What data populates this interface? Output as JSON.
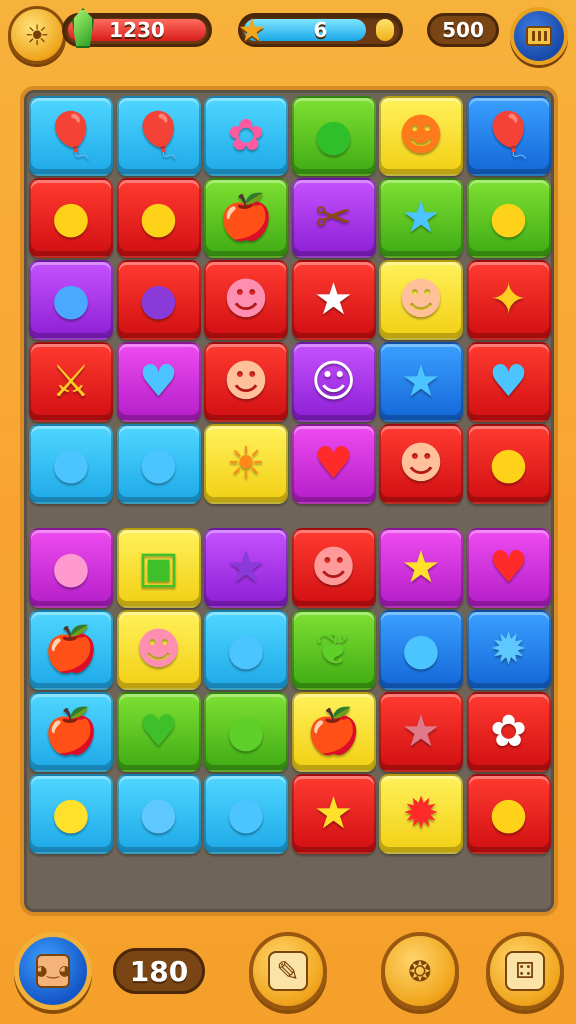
{
  "hud": {
    "hp_value": "1230",
    "level_value": "6",
    "level_progress": 0.8,
    "coins": "500",
    "avatar_icon": "sun-badge-icon",
    "gem_icon": "green-gem-icon",
    "star_icon": "star-icon",
    "pause_icon": "pause-menu-icon"
  },
  "board": {
    "columns": 6,
    "rows": [
      [
        {
          "color": "cyan",
          "item": "globe-balloon",
          "glyph": "🎈"
        },
        {
          "color": "cyan",
          "item": "blue-balloon",
          "glyph": "🎈"
        },
        {
          "color": "cyan",
          "item": "flower-bouquet",
          "glyph": "✿"
        },
        {
          "color": "green",
          "item": "green-blob",
          "glyph": "●"
        },
        {
          "color": "yellow",
          "item": "orange-face",
          "glyph": "☻"
        },
        {
          "color": "blue",
          "item": "blue-balloon",
          "glyph": "🎈"
        }
      ],
      [
        {
          "color": "red",
          "item": "yellow-balloon",
          "glyph": "●"
        },
        {
          "color": "red",
          "item": "lemon",
          "glyph": "●"
        },
        {
          "color": "green",
          "item": "red-apple",
          "glyph": "🍎"
        },
        {
          "color": "purple",
          "item": "scissors",
          "glyph": "✂"
        },
        {
          "color": "green",
          "item": "blue-star",
          "glyph": "★"
        },
        {
          "color": "green",
          "item": "lemon",
          "glyph": "●"
        }
      ],
      [
        {
          "color": "purple",
          "item": "blue-shell",
          "glyph": "●"
        },
        {
          "color": "red",
          "item": "purple-bomb",
          "glyph": "●"
        },
        {
          "color": "red",
          "item": "pink-face",
          "glyph": "☻"
        },
        {
          "color": "red",
          "item": "white-star",
          "glyph": "★"
        },
        {
          "color": "yellow",
          "item": "peach-face",
          "glyph": "☻"
        },
        {
          "color": "red",
          "item": "golden-wand",
          "glyph": "✦"
        }
      ],
      [
        {
          "color": "red",
          "item": "crossed-swords",
          "glyph": "⚔"
        },
        {
          "color": "magenta",
          "item": "blue-heart",
          "glyph": "♥"
        },
        {
          "color": "red",
          "item": "peach-face",
          "glyph": "☻"
        },
        {
          "color": "purple",
          "item": "white-face",
          "glyph": "☺"
        },
        {
          "color": "blue",
          "item": "blue-star",
          "glyph": "★"
        },
        {
          "color": "red",
          "item": "blue-heart",
          "glyph": "♥"
        }
      ],
      [
        {
          "color": "cyan",
          "item": "blue-balloon",
          "glyph": "●"
        },
        {
          "color": "cyan",
          "item": "blue-bomb",
          "glyph": "●"
        },
        {
          "color": "yellow",
          "item": "sun-flower",
          "glyph": "☀"
        },
        {
          "color": "magenta",
          "item": "red-heart",
          "glyph": "♥"
        },
        {
          "color": "red",
          "item": "peach-face",
          "glyph": "☻"
        },
        {
          "color": "red",
          "item": "lemon",
          "glyph": "●"
        }
      ],
      [
        {
          "color": "magenta",
          "item": "pink-shell",
          "glyph": "●"
        },
        {
          "color": "yellow",
          "item": "green-crate",
          "glyph": "▣"
        },
        {
          "color": "purple",
          "item": "purple-star",
          "glyph": "★"
        },
        {
          "color": "red",
          "item": "pink-block-face",
          "glyph": "☻"
        },
        {
          "color": "magenta",
          "item": "yellow-star",
          "glyph": "★"
        },
        {
          "color": "magenta",
          "item": "red-heart",
          "glyph": "♥"
        }
      ],
      [
        {
          "color": "cyan",
          "item": "red-apple",
          "glyph": "🍎"
        },
        {
          "color": "yellow",
          "item": "pink-face",
          "glyph": "☻"
        },
        {
          "color": "cyan",
          "item": "blue-heart",
          "glyph": "●"
        },
        {
          "color": "green",
          "item": "green-leaf",
          "glyph": "❦"
        },
        {
          "color": "blue",
          "item": "blue-bomb",
          "glyph": "●"
        },
        {
          "color": "blue",
          "item": "blue-bug",
          "glyph": "✹"
        }
      ],
      [
        {
          "color": "cyan",
          "item": "red-apple",
          "glyph": "🍎"
        },
        {
          "color": "green",
          "item": "green-heart",
          "glyph": "♥"
        },
        {
          "color": "green",
          "item": "green-leaf",
          "glyph": "●"
        },
        {
          "color": "yellow",
          "item": "red-apple",
          "glyph": "🍎"
        },
        {
          "color": "red",
          "item": "pink-star-face",
          "glyph": "★"
        },
        {
          "color": "red",
          "item": "white-flower",
          "glyph": "✿"
        }
      ],
      [
        {
          "color": "cyan",
          "item": "yellow-lemon",
          "glyph": "●"
        },
        {
          "color": "cyan",
          "item": "blue-bubble",
          "glyph": "●"
        },
        {
          "color": "cyan",
          "item": "blue-balloon",
          "glyph": "●"
        },
        {
          "color": "red",
          "item": "yellow-star",
          "glyph": "★"
        },
        {
          "color": "yellow",
          "item": "red-splat",
          "glyph": "✹"
        },
        {
          "color": "red",
          "item": "yellow-ball",
          "glyph": "●"
        }
      ]
    ]
  },
  "bottom": {
    "moves": "180",
    "hero_icon": "hero-portrait-icon",
    "tool1_icon": "hammer-card-icon",
    "tool2_icon": "seed-pod-icon",
    "tool3_icon": "dice-card-icon"
  },
  "colors": {
    "cyan": "#1ea9e8",
    "blue": "#1467d8",
    "green": "#3fab14",
    "yellow": "#f2cf14",
    "red": "#d10f12",
    "purple": "#8d1fd4",
    "magenta": "#b41ec9"
  },
  "glyph_colors": {
    "globe-balloon": "#2a7fd8",
    "blue-balloon": "#4cc4ff",
    "flower-bouquet": "#ff5aa0",
    "green-blob": "#2fbf2a",
    "orange-face": "#ff7a1a",
    "yellow-balloon": "#ffd21a",
    "lemon": "#ffd21a",
    "red-apple": "#e0141a",
    "scissors": "#8b4a12",
    "blue-star": "#4cc4ff",
    "blue-shell": "#4aa8ff",
    "purple-bomb": "#8a3ad8",
    "pink-face": "#ff8fb0",
    "white-star": "#ffffff",
    "peach-face": "#ffc09a",
    "golden-wand": "#ffcc22",
    "crossed-swords": "#ffcc22",
    "blue-heart": "#4cc4ff",
    "white-face": "#ffffff",
    "blue-bomb": "#4cc4ff",
    "sun-flower": "#ff8a1a",
    "red-heart": "#ff2a2a",
    "pink-shell": "#ff9ad0",
    "green-crate": "#3fbf2a",
    "purple-star": "#8a3ad8",
    "pink-block-face": "#ff9a9a",
    "yellow-star": "#ffe02a",
    "green-leaf": "#5fd02a",
    "blue-bug": "#5fc8ff",
    "green-heart": "#3fbf2a",
    "pink-star-face": "#e07a8a",
    "white-flower": "#ffffff",
    "yellow-lemon": "#ffe02a",
    "blue-bubble": "#5fc8ff",
    "red-splat": "#ff2a2a",
    "yellow-ball": "#ffd21a"
  }
}
